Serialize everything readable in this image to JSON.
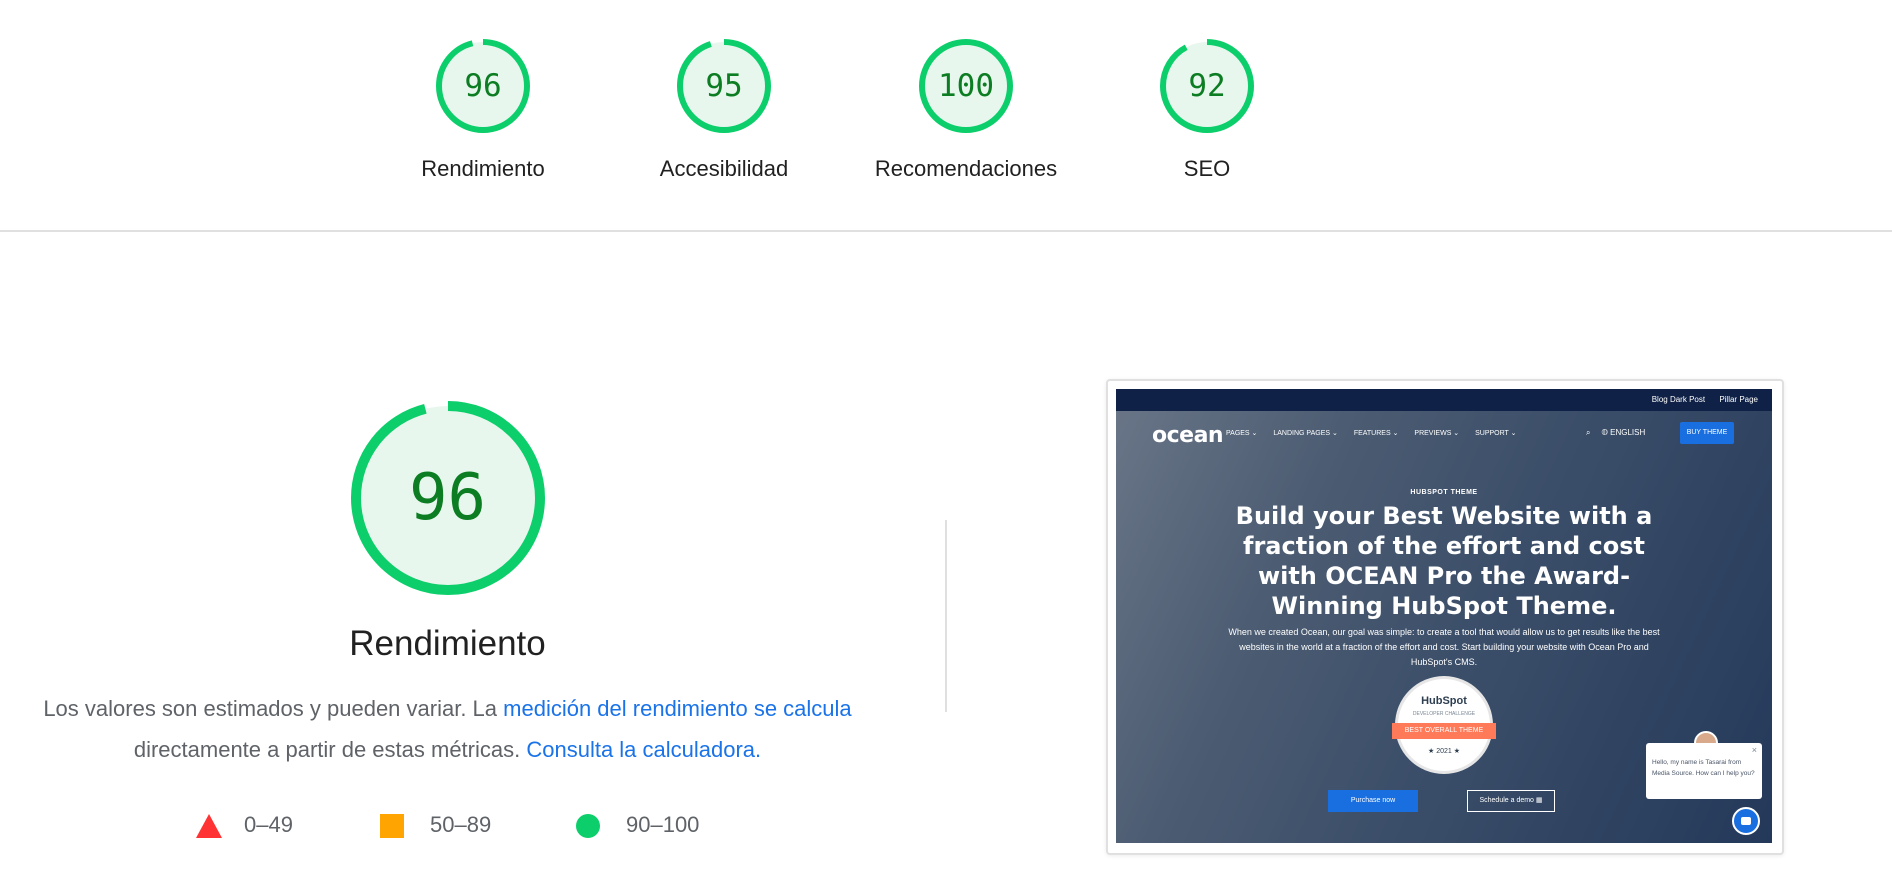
{
  "colors": {
    "pass": "#0cce6b",
    "pass_text": "#0c7d22",
    "pass_fill": "#e8f7ee",
    "average": "#ffa400",
    "fail": "#ff3333",
    "link": "#1a73e8"
  },
  "gauges": [
    {
      "score": "96",
      "label": "Rendimiento"
    },
    {
      "score": "95",
      "label": "Accesibilidad"
    },
    {
      "score": "100",
      "label": "Recomendaciones"
    },
    {
      "score": "92",
      "label": "SEO"
    }
  ],
  "performance": {
    "score": "96",
    "title": "Rendimiento",
    "desc_prefix": "Los valores son estimados y pueden variar. La ",
    "desc_link1": "medición del rendimiento se calcula",
    "desc_middle": " directamente a partir de estas métricas. ",
    "desc_link2": "Consulta la calculadora."
  },
  "legend": [
    {
      "icon": "triangle-icon",
      "range": "0–49"
    },
    {
      "icon": "square-icon",
      "range": "50–89"
    },
    {
      "icon": "circle-icon",
      "range": "90–100"
    }
  ],
  "screenshot": {
    "topbar_links": [
      "Blog Dark Post",
      "Pillar Page"
    ],
    "logo": "ocean",
    "menu": [
      "PAGES ⌄",
      "LANDING PAGES ⌄",
      "FEATURES ⌄",
      "PREVIEWS ⌄",
      "SUPPORT ⌄"
    ],
    "lang": "ENGLISH",
    "buy_button": "BUY THEME",
    "eyebrow": "HUBSPOT THEME",
    "headline": "Build your Best Website with a fraction of the effort and cost with OCEAN Pro the Award-Winning HubSpot Theme.",
    "subtext": "When we created Ocean, our goal was simple: to create a tool that would allow us to get results like the best websites in the world at a fraction of the effort and cost. Start building your website with Ocean Pro and HubSpot's CMS.",
    "badge_brand": "HubSpot",
    "badge_challenge": "DEVELOPER CHALLENGE",
    "badge_ribbon": "BEST OVERALL THEME",
    "badge_year": "★ 2021 ★",
    "purchase_button": "Purchase now",
    "schedule_button": "Schedule a demo",
    "chat_message": "Hello, my name is Tasarai from Media Source. How can I help you?",
    "chat_close": "×"
  }
}
